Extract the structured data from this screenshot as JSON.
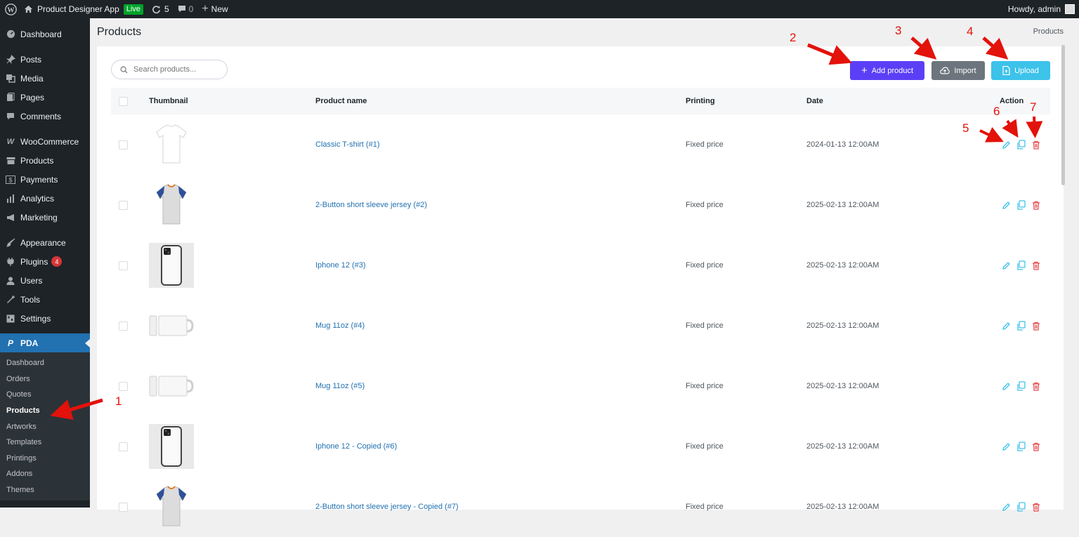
{
  "adminbar": {
    "site_name": "Product Designer App",
    "live_badge": "Live",
    "updates_count": "5",
    "comments_count": "0",
    "new_label": "New",
    "greeting": "Howdy, admin"
  },
  "sidebar": {
    "items": [
      {
        "label": "Dashboard",
        "icon": "dashboard-icon"
      },
      {
        "label": "Posts",
        "icon": "pin-icon"
      },
      {
        "label": "Media",
        "icon": "media-icon"
      },
      {
        "label": "Pages",
        "icon": "page-icon"
      },
      {
        "label": "Comments",
        "icon": "comment-icon"
      },
      {
        "label": "WooCommerce",
        "icon": "woo-icon"
      },
      {
        "label": "Products",
        "icon": "archive-icon"
      },
      {
        "label": "Payments",
        "icon": "dollar-icon"
      },
      {
        "label": "Analytics",
        "icon": "chart-icon"
      },
      {
        "label": "Marketing",
        "icon": "megaphone-icon"
      },
      {
        "label": "Appearance",
        "icon": "brush-icon"
      },
      {
        "label": "Plugins",
        "icon": "plug-icon",
        "badge": "4"
      },
      {
        "label": "Users",
        "icon": "user-icon"
      },
      {
        "label": "Tools",
        "icon": "wrench-icon"
      },
      {
        "label": "Settings",
        "icon": "settings-icon"
      }
    ],
    "pda_label": "PDA",
    "submenu": [
      "Dashboard",
      "Orders",
      "Quotes",
      "Products",
      "Artworks",
      "Templates",
      "Printings",
      "Addons",
      "Themes"
    ],
    "current_submenu": "Products"
  },
  "page": {
    "title": "Products",
    "breadcrumb": "Products"
  },
  "toolbar": {
    "search_placeholder": "Search products...",
    "add_label": "Add product",
    "import_label": "Import",
    "upload_label": "Upload"
  },
  "table": {
    "headers": {
      "thumbnail": "Thumbnail",
      "name": "Product name",
      "printing": "Printing",
      "date": "Date",
      "action": "Action"
    },
    "rows": [
      {
        "name": "Classic T-shirt (#1)",
        "printing": "Fixed price",
        "date": "2024-01-13 12:00AM",
        "thumb": "tshirt"
      },
      {
        "name": "2-Button short sleeve jersey (#2)",
        "printing": "Fixed price",
        "date": "2025-02-13 12:00AM",
        "thumb": "jersey"
      },
      {
        "name": "Iphone 12 (#3)",
        "printing": "Fixed price",
        "date": "2025-02-13 12:00AM",
        "thumb": "phone"
      },
      {
        "name": "Mug 11oz (#4)",
        "printing": "Fixed price",
        "date": "2025-02-13 12:00AM",
        "thumb": "mug"
      },
      {
        "name": "Mug 11oz (#5)",
        "printing": "Fixed price",
        "date": "2025-02-13 12:00AM",
        "thumb": "mug"
      },
      {
        "name": "Iphone 12 - Copied (#6)",
        "printing": "Fixed price",
        "date": "2025-02-13 12:00AM",
        "thumb": "phone"
      },
      {
        "name": "2-Button short sleeve jersey - Copied (#7)",
        "printing": "Fixed price",
        "date": "2025-02-13 12:00AM",
        "thumb": "jersey"
      }
    ]
  },
  "annotations": {
    "n1": "1",
    "n2": "2",
    "n3": "3",
    "n4": "4",
    "n5": "5",
    "n6": "6",
    "n7": "7"
  },
  "colors": {
    "sidebar_bg": "#1d2327",
    "accent_blue": "#2271b1",
    "add_button": "#5b3ff6",
    "import_button": "#6c757d",
    "upload_button": "#3dc2ea",
    "delete_icon": "#e5484d",
    "annotation_red": "#e3120b"
  }
}
